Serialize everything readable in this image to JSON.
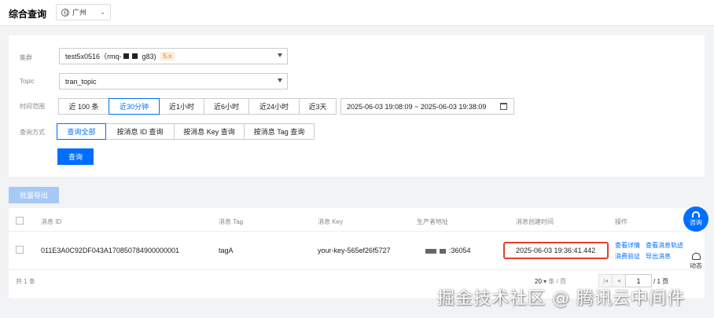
{
  "header": {
    "title": "综合查询",
    "region": "广州"
  },
  "form": {
    "cluster_label": "集群",
    "cluster_value_prefix": "test5x0516（rmq-",
    "cluster_value_suffix": "g83)",
    "cluster_badge": "5.x",
    "topic_label": "Topic",
    "topic_value": "tran_topic",
    "time_label": "时间范围",
    "time_options": [
      "近 100 条",
      "近30分钟",
      "近1小时",
      "近6小时",
      "近24小时",
      "近3天"
    ],
    "time_active_index": 1,
    "time_range": "2025-06-03 19:08:09 ~ 2025-06-03 19:38:09",
    "mode_label": "查询方式",
    "mode_options": [
      "查询全部",
      "按消息 ID 查询",
      "按消息 Key 查询",
      "按消息 Tag 查询"
    ],
    "mode_active_index": 0,
    "query_button": "查询"
  },
  "batch_export": "批量导出",
  "table": {
    "headers": [
      "消息 ID",
      "消息 Tag",
      "消息 Key",
      "生产者地址",
      "消息创建时间",
      "操作"
    ],
    "rows": [
      {
        "id": "011E3A0C92DF043A170850784900000001",
        "tag": "tagA",
        "key": "your-key-565ef26f5727",
        "producer_suffix": ":36054",
        "created": "2025-06-03 19:36:41.442",
        "actions": [
          "查看详情",
          "查看消息轨迹",
          "消费验证",
          "导出消息"
        ]
      }
    ]
  },
  "pagination": {
    "total": "共 1 条",
    "page_size": "20",
    "per_page_unit": "条 / 页",
    "current_page": "1",
    "total_pages": "/ 1 页"
  },
  "float": {
    "consult": "咨询",
    "dynamic": "动态"
  },
  "watermark": "掘金技术社区 @ 腾讯云中间件"
}
